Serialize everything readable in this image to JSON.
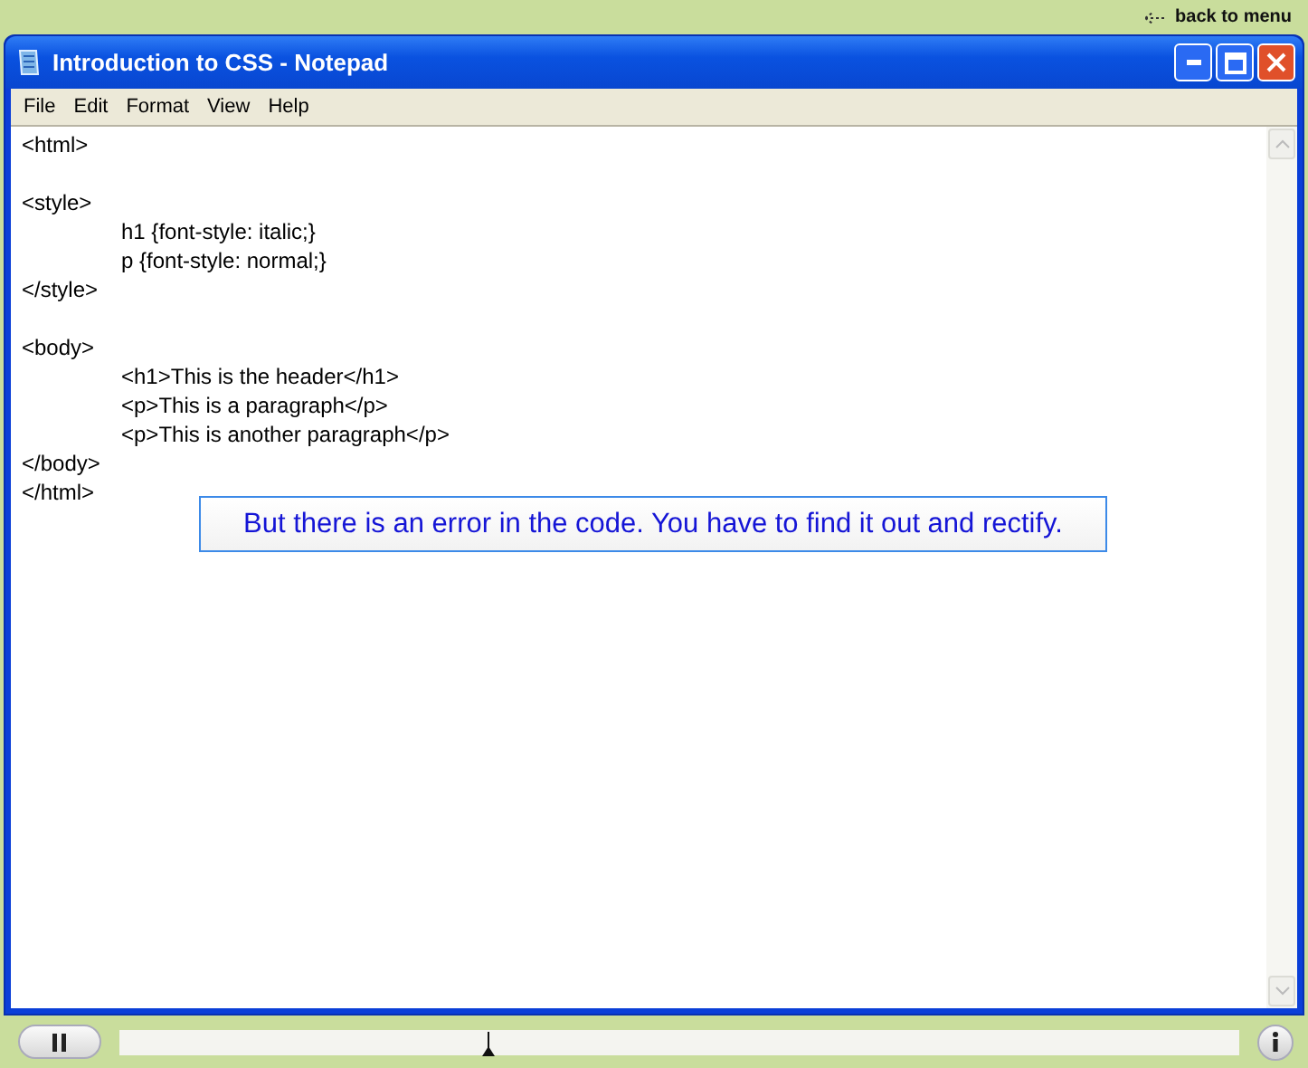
{
  "top_bar": {
    "back_link": "back to menu"
  },
  "window": {
    "title": "Introduction to CSS - Notepad"
  },
  "menu": [
    "File",
    "Edit",
    "Format",
    "View",
    "Help"
  ],
  "editor": {
    "lines": [
      {
        "kind": "plain",
        "text": "<html>"
      },
      {
        "kind": "blank"
      },
      {
        "kind": "plain",
        "text": "<style>"
      },
      {
        "kind": "indented",
        "text": "h1 {font-style: italic;}"
      },
      {
        "kind": "indented",
        "text": "p {font-style: normal;}"
      },
      {
        "kind": "plain",
        "text": "</style>"
      },
      {
        "kind": "blank"
      },
      {
        "kind": "plain",
        "text": "<body>"
      },
      {
        "kind": "indented",
        "text": "<h1>This is the header</h1>"
      },
      {
        "kind": "indented",
        "text": "<p>This is a paragraph</p>"
      },
      {
        "kind": "indented",
        "text": "<p>This is another paragraph</p>"
      },
      {
        "kind": "plain",
        "text": "</body>"
      },
      {
        "kind": "plain",
        "text": "</html>"
      }
    ]
  },
  "callout": "But there is an error in the code. You have to find it out and rectify.",
  "player": {
    "level": 0.33
  }
}
